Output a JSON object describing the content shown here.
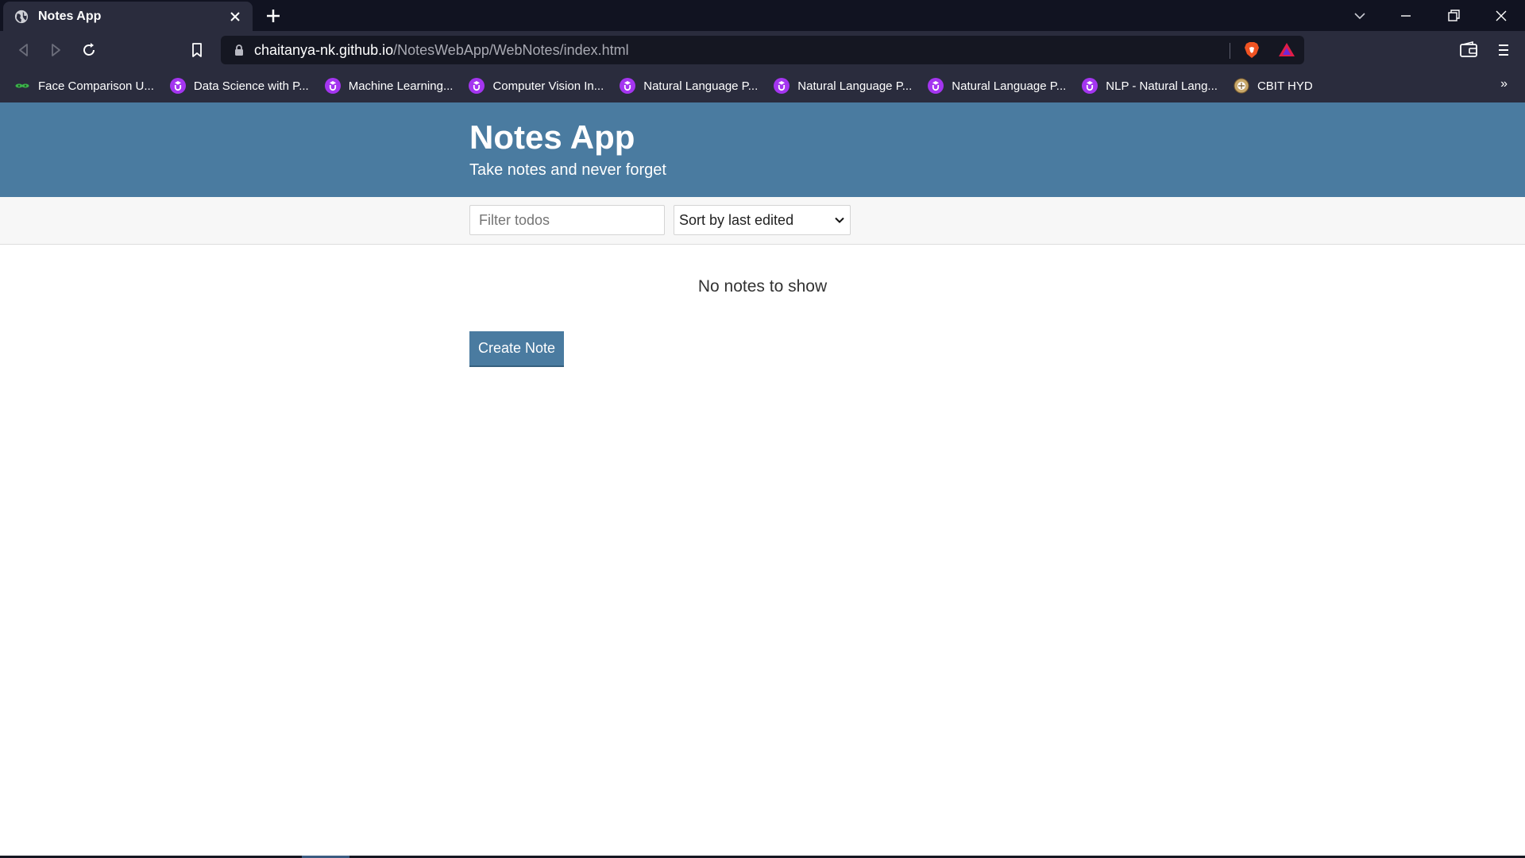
{
  "browser": {
    "tab": {
      "title": "Notes App"
    },
    "url": {
      "host": "chaitanya-nk.github.io",
      "path": "/NotesWebApp/WebNotes/index.html"
    },
    "bookmarks": [
      {
        "label": "Face Comparison U...",
        "icon": "green-eyes-icon"
      },
      {
        "label": "Data Science with P...",
        "icon": "udemy-icon"
      },
      {
        "label": "Machine Learning...",
        "icon": "udemy-icon"
      },
      {
        "label": "Computer Vision In...",
        "icon": "udemy-icon"
      },
      {
        "label": "Natural Language P...",
        "icon": "udemy-icon"
      },
      {
        "label": "Natural Language P...",
        "icon": "udemy-icon"
      },
      {
        "label": "Natural Language P...",
        "icon": "udemy-icon"
      },
      {
        "label": "NLP - Natural Lang...",
        "icon": "udemy-icon"
      },
      {
        "label": "CBIT HYD",
        "icon": "cbit-logo-icon"
      }
    ],
    "bookmarks_more": "»"
  },
  "app": {
    "title": "Notes App",
    "subtitle": "Take notes and never forget",
    "filter": {
      "placeholder": "Filter todos",
      "value": ""
    },
    "sort": {
      "selected": "Sort by last edited"
    },
    "empty_message": "No notes to show",
    "create_button": "Create Note"
  },
  "colors": {
    "header": "#4a7ba0",
    "chrome_dark": "#111321",
    "chrome_toolbar": "#2a2c3d",
    "udemy_purple": "#a435f0"
  }
}
